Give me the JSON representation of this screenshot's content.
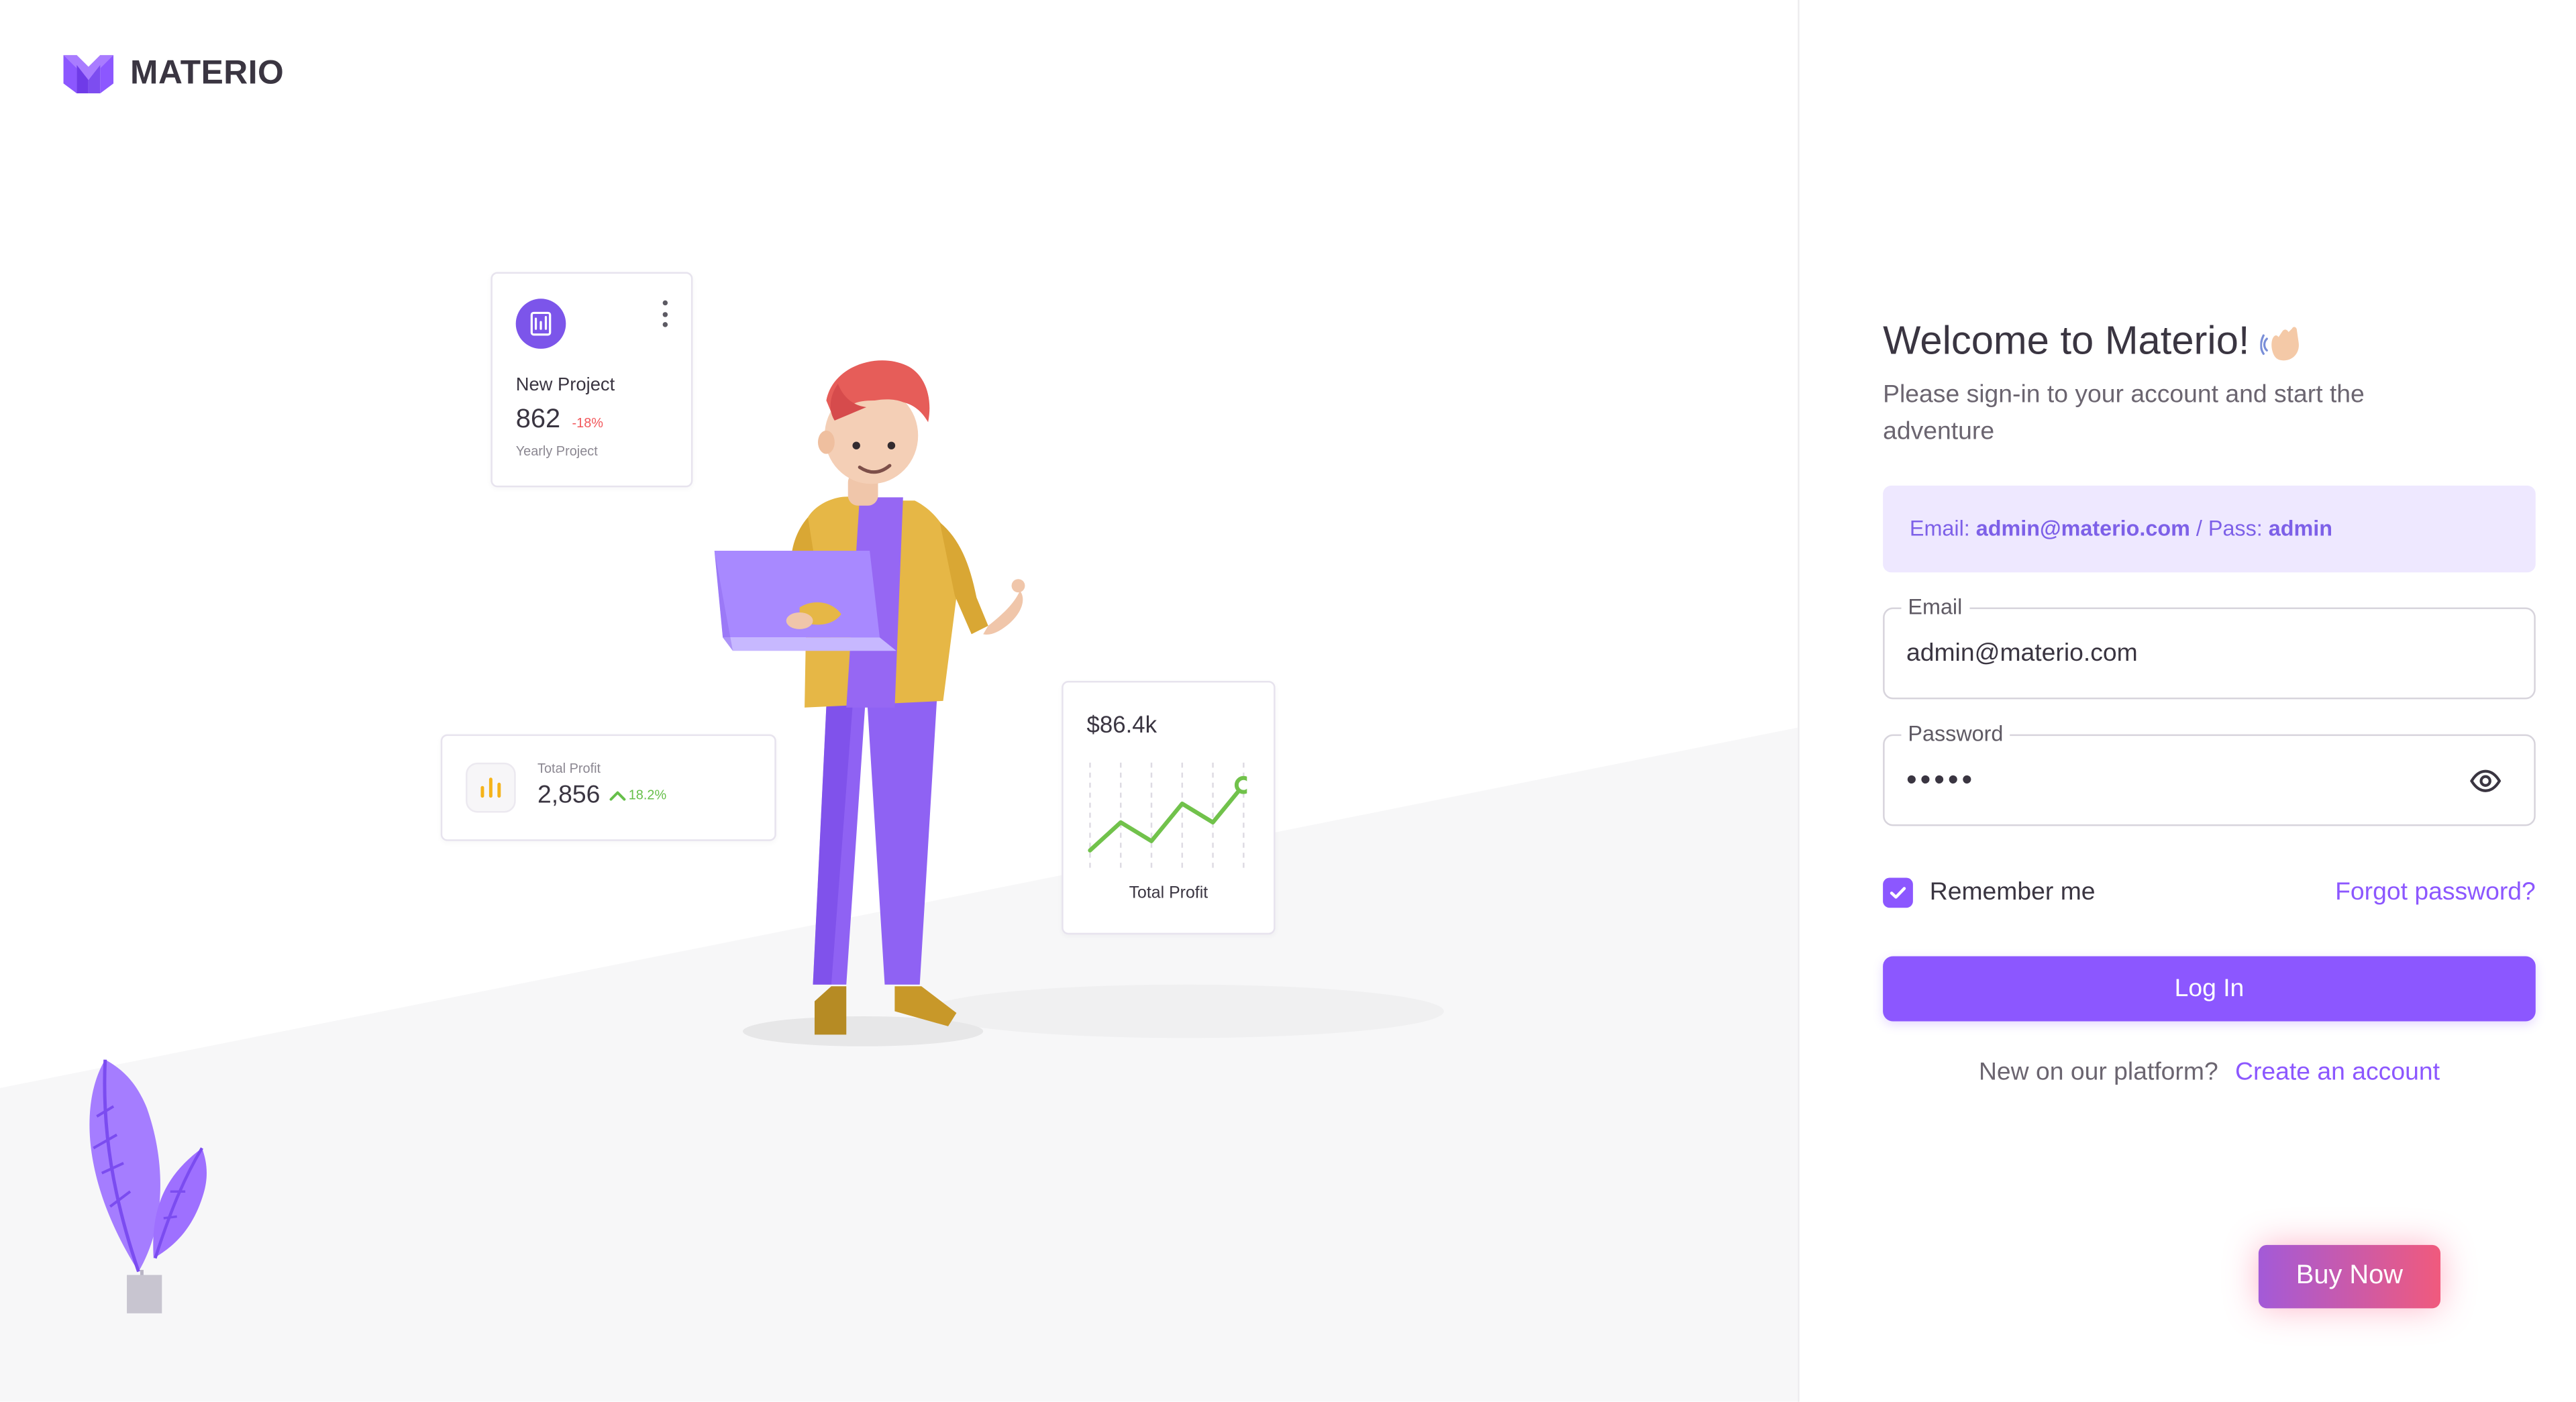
{
  "brand": {
    "name": "MATERIO",
    "logo_icon": "materio-m-logo-icon"
  },
  "cards": {
    "new_project": {
      "title": "New Project",
      "value": "862",
      "change": "-18%",
      "subtitle": "Yearly Project",
      "icon": "document-icon",
      "menu_icon": "kebab-menu-icon"
    },
    "total_profit_small": {
      "label": "Total Profit",
      "value": "2,856",
      "change": "18.2%",
      "icon": "bar-chart-icon",
      "trend_icon": "chevron-up-icon"
    },
    "total_profit_chart": {
      "value": "$86.4k",
      "label": "Total Profit"
    }
  },
  "chart_data": {
    "type": "line",
    "categories": [
      "1",
      "2",
      "3",
      "4",
      "5",
      "6"
    ],
    "series": [
      {
        "values": [
          15,
          45,
          25,
          65,
          45,
          85
        ]
      }
    ],
    "ylim": [
      0,
      100
    ],
    "xlabel": "",
    "ylabel": ""
  },
  "login": {
    "title": "Welcome to Materio!",
    "title_icon": "waving-hand-icon",
    "subtitle": "Please sign-in to your account and start the adventure",
    "demo": {
      "email_label": "Email:",
      "email_value": "admin@materio.com",
      "separator": "/ Pass:",
      "password_value": "admin"
    },
    "email": {
      "label": "Email",
      "value": "admin@materio.com"
    },
    "password": {
      "label": "Password",
      "value": "•••••",
      "icon": "eye-icon"
    },
    "remember_label": "Remember me",
    "forgot_label": "Forgot password?",
    "submit_label": "Log In",
    "signup_prompt": "New on our platform?",
    "signup_link": "Create an account",
    "buy_label": "Buy Now"
  },
  "colors": {
    "primary": "#8C57FF",
    "demo_background": "#EEE8FF",
    "positive": "#66BF4A",
    "negative": "#F2575B",
    "warning": "#F5B31A"
  }
}
